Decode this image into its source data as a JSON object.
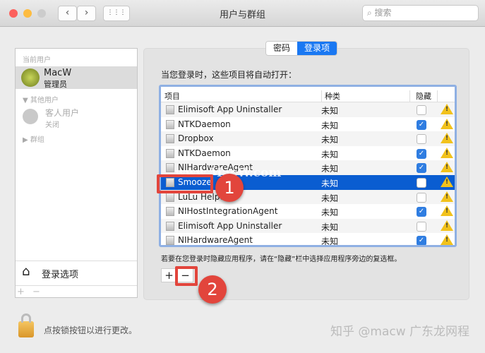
{
  "window": {
    "title": "用户与群组",
    "search_placeholder": "搜索",
    "colors": {
      "accent": "#0a5dd1",
      "annotation": "#e2453c"
    }
  },
  "toolbar": {
    "back": "‹",
    "forward": "›",
    "grid": "⋮⋮⋮"
  },
  "sidebar": {
    "current_user_header": "当前用户",
    "current_user": {
      "name": "MacW",
      "role": "管理员"
    },
    "other_users_header": "其他用户",
    "guest": {
      "name": "客人用户",
      "status": "关闭"
    },
    "groups": "群组",
    "login_options": "登录选项",
    "add": "+",
    "remove": "−"
  },
  "tabs": [
    {
      "label": "密码"
    },
    {
      "label": "登录项"
    }
  ],
  "main": {
    "intro": "当您登录时，这些项目将自动打开：",
    "columns": [
      "项目",
      "种类",
      "隐藏"
    ],
    "rows": [
      {
        "name": "Elimisoft App Uninstaller",
        "kind": "未知",
        "hidden": false
      },
      {
        "name": "NTKDaemon",
        "kind": "未知",
        "hidden": true
      },
      {
        "name": "Dropbox",
        "kind": "未知",
        "hidden": false
      },
      {
        "name": "NTKDaemon",
        "kind": "未知",
        "hidden": true
      },
      {
        "name": "NIHardwareAgent",
        "kind": "未知",
        "hidden": true
      },
      {
        "name": "Smooze",
        "kind": "未知",
        "hidden": false,
        "selected": true
      },
      {
        "name": "LuLu Helper",
        "kind": "未知",
        "hidden": false
      },
      {
        "name": "NIHostIntegrationAgent",
        "kind": "未知",
        "hidden": true
      },
      {
        "name": "Elimisoft App Uninstaller",
        "kind": "未知",
        "hidden": false
      },
      {
        "name": "NIHardwareAgent",
        "kind": "未知",
        "hidden": true
      }
    ],
    "note": "若要在您登录时隐藏应用程序，请在“隐藏”栏中选择应用程序旁边的复选框。",
    "add": "+",
    "remove": "−"
  },
  "annotations": [
    "1",
    "2"
  ],
  "footer": {
    "lock_text": "点按锁按钮以进行更改。"
  },
  "watermarks": {
    "center": "www.MacW.com",
    "bottom": "知乎 @macw 广东龙网程"
  }
}
